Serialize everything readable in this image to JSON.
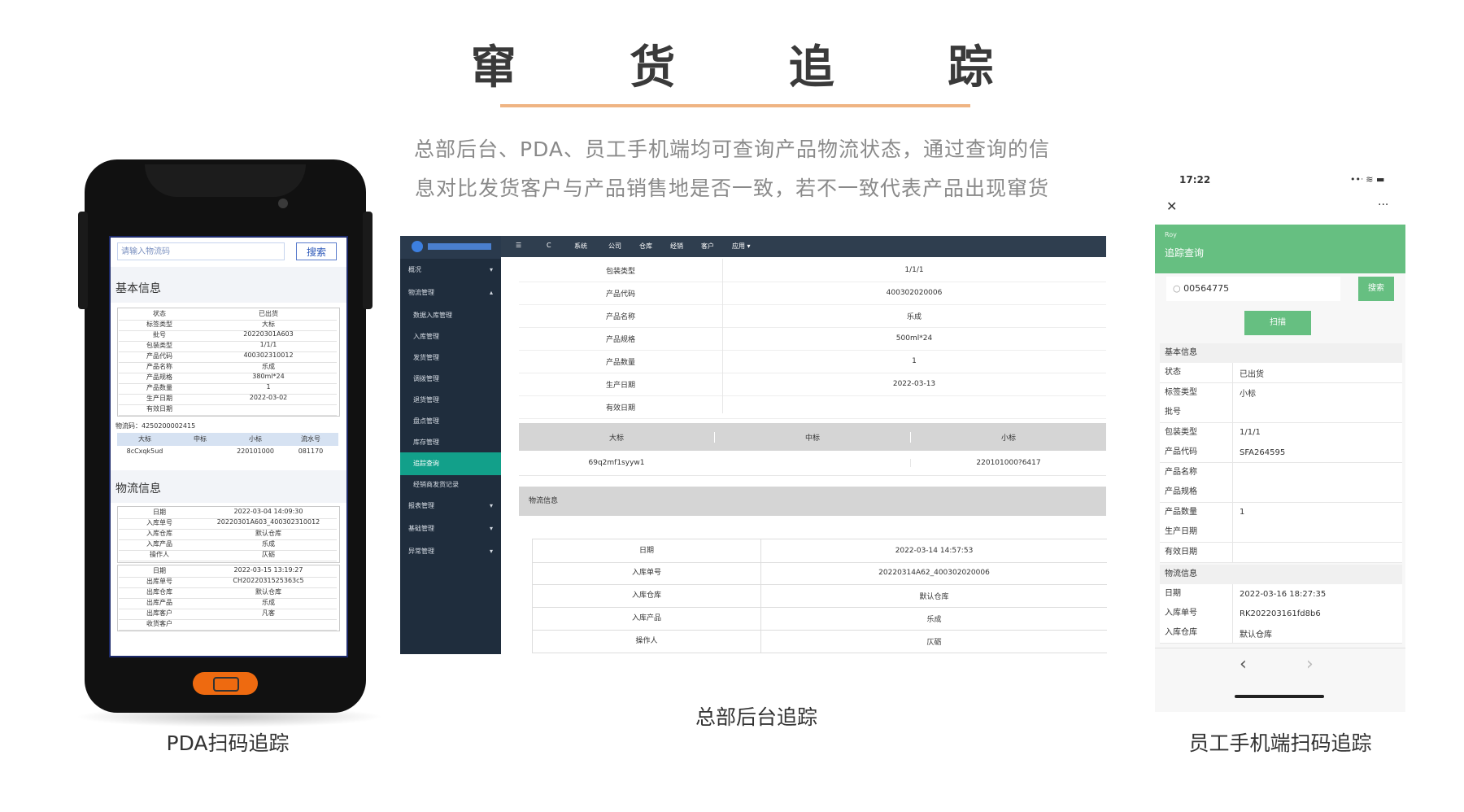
{
  "title": "窜 货 追 踪",
  "description": {
    "line1": "总部后台、PDA、员工手机端均可查询产品物流状态，通过查询的信",
    "line2": "息对比发货客户与产品销售地是否一致，若不一致代表产品出现窜货"
  },
  "captions": {
    "pda": "PDA扫码追踪",
    "admin": "总部后台追踪",
    "mobile": "员工手机端扫码追踪"
  },
  "colors": {
    "accent": "#efb483",
    "green": "#66bf81",
    "teal": "#12a08a",
    "orange": "#ee6a10"
  },
  "pda": {
    "search_placeholder": "请输入物流码",
    "search_button": "搜索",
    "basic_title": "基本信息",
    "basic_rows": [
      {
        "k": "状态",
        "v": "已出货"
      },
      {
        "k": "标签类型",
        "v": "大标"
      },
      {
        "k": "批号",
        "v": "20220301A603"
      },
      {
        "k": "包装类型",
        "v": "1/1/1"
      },
      {
        "k": "产品代码",
        "v": "400302310012"
      },
      {
        "k": "产品名称",
        "v": "乐成"
      },
      {
        "k": "产品规格",
        "v": "380ml*24"
      },
      {
        "k": "产品数量",
        "v": "1"
      },
      {
        "k": "生产日期",
        "v": "2022-03-02"
      },
      {
        "k": "有效日期",
        "v": ""
      }
    ],
    "logistics_code": "物流码：4250200002415",
    "label_headers": [
      "大标",
      "中标",
      "小标",
      "流水号"
    ],
    "label_values": [
      "8cCxqk5ud",
      "",
      "220101000",
      "081170"
    ],
    "logistics_title": "物流信息",
    "log_group1": [
      {
        "k": "日期",
        "v": "2022-03-04 14:09:30"
      },
      {
        "k": "入库单号",
        "v": "20220301A603_400302310012"
      },
      {
        "k": "入库仓库",
        "v": "默认仓库"
      },
      {
        "k": "入库产品",
        "v": "乐成"
      },
      {
        "k": "操作人",
        "v": "仄砺"
      }
    ],
    "log_group2": [
      {
        "k": "日期",
        "v": "2022-03-15 13:19:27"
      },
      {
        "k": "出库单号",
        "v": "CH2022031525363c5"
      },
      {
        "k": "出库仓库",
        "v": "默认仓库"
      },
      {
        "k": "出库产品",
        "v": "乐成"
      },
      {
        "k": "出库客户",
        "v": "凡客"
      },
      {
        "k": "收货客户",
        "v": ""
      }
    ]
  },
  "admin": {
    "top_menu": [
      "☰",
      "C",
      "系统",
      "公司",
      "仓库",
      "经销",
      "客户",
      "应用 ▾"
    ],
    "sidebar": [
      {
        "label": "概况",
        "arrow": "▾"
      },
      {
        "label": "物流管理",
        "arrow": "▴"
      },
      {
        "label": "数据入库管理",
        "arrow": ""
      },
      {
        "label": "入库管理",
        "arrow": ""
      },
      {
        "label": "发货管理",
        "arrow": ""
      },
      {
        "label": "调拨管理",
        "arrow": ""
      },
      {
        "label": "退货管理",
        "arrow": ""
      },
      {
        "label": "盘点管理",
        "arrow": ""
      },
      {
        "label": "库存管理",
        "arrow": ""
      },
      {
        "label": "追踪查询",
        "arrow": ""
      },
      {
        "label": "经销商发货记录",
        "arrow": ""
      },
      {
        "label": "报表管理",
        "arrow": "▾"
      },
      {
        "label": "基础管理",
        "arrow": "▾"
      },
      {
        "label": "异常管理",
        "arrow": "▾"
      }
    ],
    "detail_rows": [
      {
        "k": "包装类型",
        "v": "1/1/1"
      },
      {
        "k": "产品代码",
        "v": "400302020006"
      },
      {
        "k": "产品名称",
        "v": "乐成"
      },
      {
        "k": "产品规格",
        "v": "500ml*24"
      },
      {
        "k": "产品数量",
        "v": "1"
      },
      {
        "k": "生产日期",
        "v": "2022-03-13"
      },
      {
        "k": "有效日期",
        "v": ""
      }
    ],
    "label_headers": [
      "大标",
      "中标",
      "小标"
    ],
    "label_values": [
      "69q2mf1syyw1",
      "",
      "220101000?6417"
    ],
    "logistics_title": "物流信息",
    "log_rows": [
      {
        "k": "日期",
        "v": "2022-03-14 14:57:53"
      },
      {
        "k": "入库单号",
        "v": "20220314A62_400302020006"
      },
      {
        "k": "入库仓库",
        "v": "默认仓库"
      },
      {
        "k": "入库产品",
        "v": "乐成"
      },
      {
        "k": "操作人",
        "v": "仄砺"
      }
    ]
  },
  "mobile": {
    "time": "17:22",
    "status_icons": "••ᐧ ≋ ▬",
    "close": "✕",
    "more": "···",
    "user": "Roy",
    "page_title": "追踪查询",
    "search_value": "00564775",
    "search_button": "搜索",
    "scan_button": "扫描",
    "basic_title": "基本信息",
    "basic_rows": [
      {
        "k": "状态",
        "v": "已出货"
      },
      {
        "k": "标签类型",
        "v": "小标"
      },
      {
        "k": "批号",
        "v": ""
      },
      {
        "k": "包装类型",
        "v": "1/1/1"
      },
      {
        "k": "产品代码",
        "v": "SFA264595"
      },
      {
        "k": "产品名称",
        "v": ""
      },
      {
        "k": "产品规格",
        "v": ""
      },
      {
        "k": "产品数量",
        "v": "1"
      },
      {
        "k": "生产日期",
        "v": ""
      },
      {
        "k": "有效日期",
        "v": ""
      }
    ],
    "logistics_title": "物流信息",
    "log_rows": [
      {
        "k": "日期",
        "v": "2022-03-16 18:27:35"
      },
      {
        "k": "入库单号",
        "v": "RK202203161fd8b6"
      },
      {
        "k": "入库仓库",
        "v": "默认仓库"
      }
    ],
    "nav_back": "‹",
    "nav_forward": "›"
  }
}
